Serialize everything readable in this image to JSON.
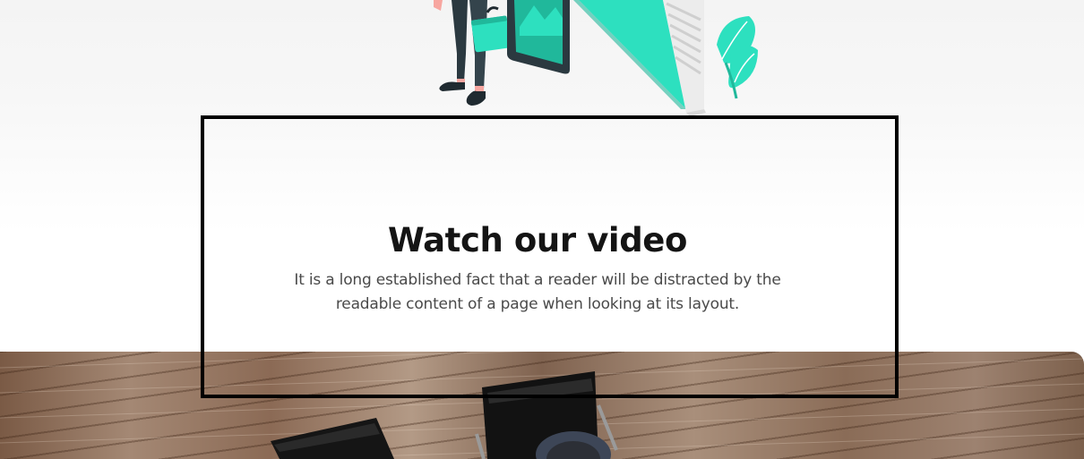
{
  "video_section": {
    "title": "Watch our video",
    "description": "It is a long established fact that a reader will be distracted by the readable content of a page when looking at its layout."
  },
  "illustration": {
    "icon": "businessman-presentation-illustration",
    "accent_color": "#2de0bf",
    "secondary_color": "#20b89b",
    "dark_color": "#2b3940"
  },
  "video_poster": {
    "icon": "office-desk-photo",
    "base_color": "#8e705b"
  }
}
